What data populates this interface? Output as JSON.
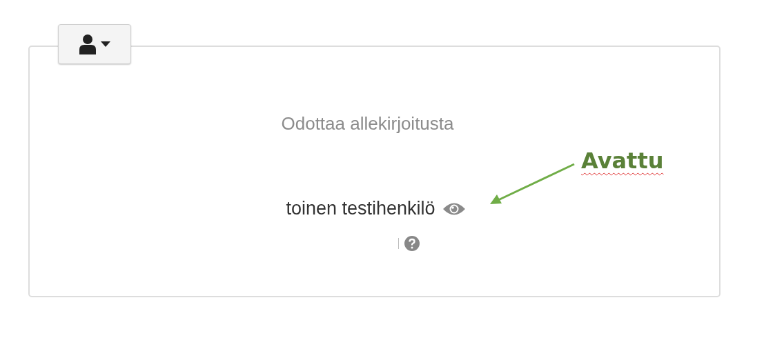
{
  "status": "Odottaa allekirjoitusta",
  "signer": {
    "name": "toinen testihenkilö"
  },
  "annotation": {
    "label": "Avattu"
  }
}
